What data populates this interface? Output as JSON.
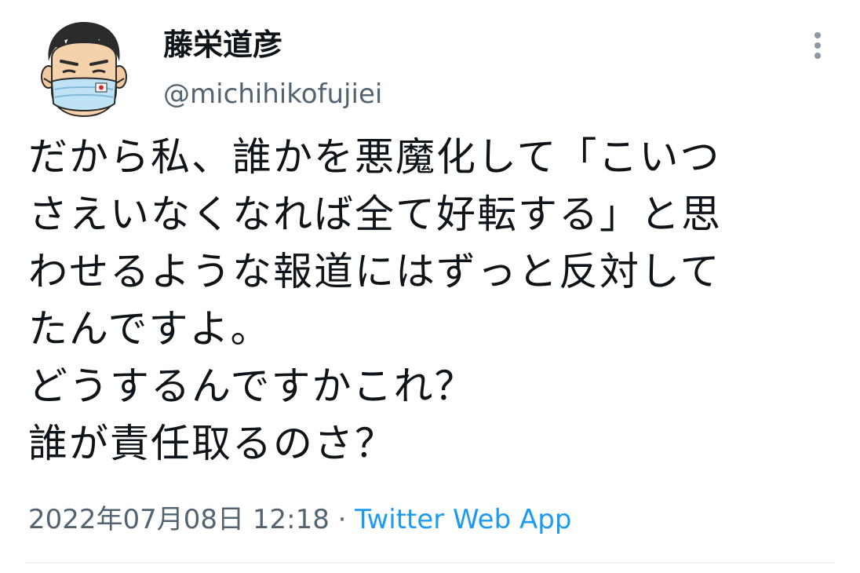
{
  "tweet": {
    "author": {
      "display_name": "藤栄道彦",
      "handle": "@michihikofujiei",
      "avatar_icon": "cartoon-avatar-masked-man"
    },
    "more_icon": "more-vertical-icon",
    "text_lines": [
      "だから私、誰かを悪魔化して「こいつ",
      "さえいなくなれば全て好転する」と思",
      "わせるような報道にはずっと反対して",
      "たんですよ。",
      "どうするんですかこれ？",
      "誰が責任取るのさ？"
    ],
    "timestamp": "2022年07月08日 12:18",
    "separator": " · ",
    "source": "Twitter Web App"
  },
  "colors": {
    "text": "#0f1419",
    "secondary": "#536471",
    "link": "#1d9bf0",
    "divider": "#eff3f4"
  }
}
